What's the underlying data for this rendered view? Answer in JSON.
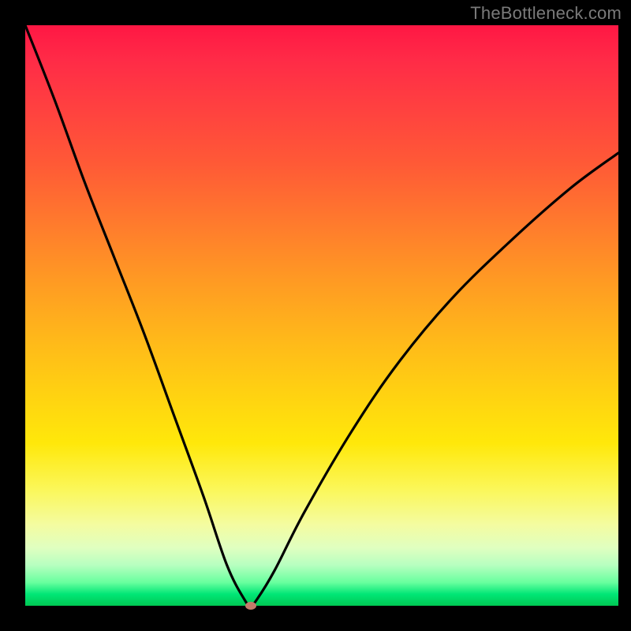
{
  "watermark": "TheBottleneck.com",
  "chart_data": {
    "type": "line",
    "title": "",
    "xlabel": "",
    "ylabel": "",
    "xlim": [
      0,
      100
    ],
    "ylim": [
      0,
      100
    ],
    "grid": false,
    "legend": false,
    "background_gradient": {
      "direction": "vertical",
      "stops": [
        {
          "pos": 0,
          "color": "#ff1744"
        },
        {
          "pos": 50,
          "color": "#ffd311"
        },
        {
          "pos": 100,
          "color": "#00c853"
        }
      ],
      "meaning": "top=high bottleneck (red), bottom=low bottleneck (green)"
    },
    "series": [
      {
        "name": "bottleneck-curve",
        "color": "#000000",
        "x": [
          0,
          5,
          10,
          15,
          20,
          25,
          30,
          34,
          37,
          38,
          39,
          42,
          47,
          55,
          63,
          72,
          82,
          92,
          100
        ],
        "y": [
          100,
          87,
          73,
          60,
          47,
          33,
          19,
          7,
          1,
          0,
          1,
          6,
          16,
          30,
          42,
          53,
          63,
          72,
          78
        ]
      }
    ],
    "annotations": [
      {
        "type": "marker",
        "name": "optimal-point",
        "x": 38,
        "y": 0,
        "color": "#c47a6a",
        "shape": "ellipse"
      }
    ]
  },
  "plot": {
    "inner_left": 32,
    "inner_top": 32,
    "inner_width": 752,
    "inner_height": 736
  }
}
